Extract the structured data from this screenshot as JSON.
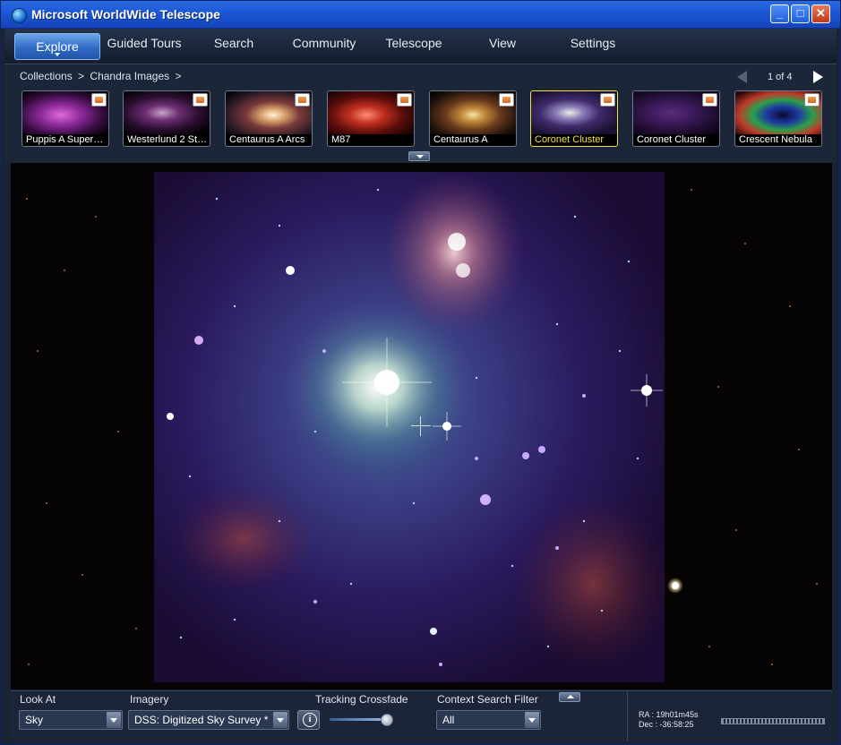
{
  "window": {
    "title": "Microsoft WorldWide Telescope"
  },
  "menu": {
    "active": "Explore",
    "items": [
      "Guided Tours",
      "Search",
      "Community",
      "Telescope",
      "View",
      "Settings"
    ]
  },
  "breadcrumb": {
    "part1": "Collections",
    "sep": ">",
    "part2": "Chandra Images",
    "trailing": ">"
  },
  "pager": {
    "text": "1 of 4"
  },
  "thumbnails": [
    {
      "label": "Puppis A Supern...",
      "selected": false
    },
    {
      "label": "Westerlund 2 Sta...",
      "selected": false
    },
    {
      "label": "Centaurus A Arcs",
      "selected": false
    },
    {
      "label": "M87",
      "selected": false
    },
    {
      "label": "Centaurus A",
      "selected": false
    },
    {
      "label": "Coronet Cluster",
      "selected": true
    },
    {
      "label": "Coronet Cluster",
      "selected": false
    },
    {
      "label": "Crescent Nebula",
      "selected": false
    }
  ],
  "controls": {
    "look_at_label": "Look At",
    "look_at_value": "Sky",
    "imagery_label": "Imagery",
    "imagery_value": "DSS: Digitized Sky Survey *",
    "tracking_label": "Tracking Crossfade",
    "context_label": "Context Search Filter",
    "context_value": "All",
    "crossfade_level": 0.9
  },
  "coordinates": {
    "ra": "RA :  19h01m45s",
    "dec": "Dec :  -36:58:25"
  },
  "colors": {
    "title_blue": "#1d58d6",
    "panel": "#1b2537",
    "selected_border": "#f2e33a"
  },
  "icons": [
    "app-globe-icon",
    "minimize-icon",
    "maximize-icon",
    "close-icon",
    "prev-arrow-icon",
    "next-arrow-icon",
    "info-icon",
    "chevron-down-icon",
    "chevron-up-icon"
  ]
}
